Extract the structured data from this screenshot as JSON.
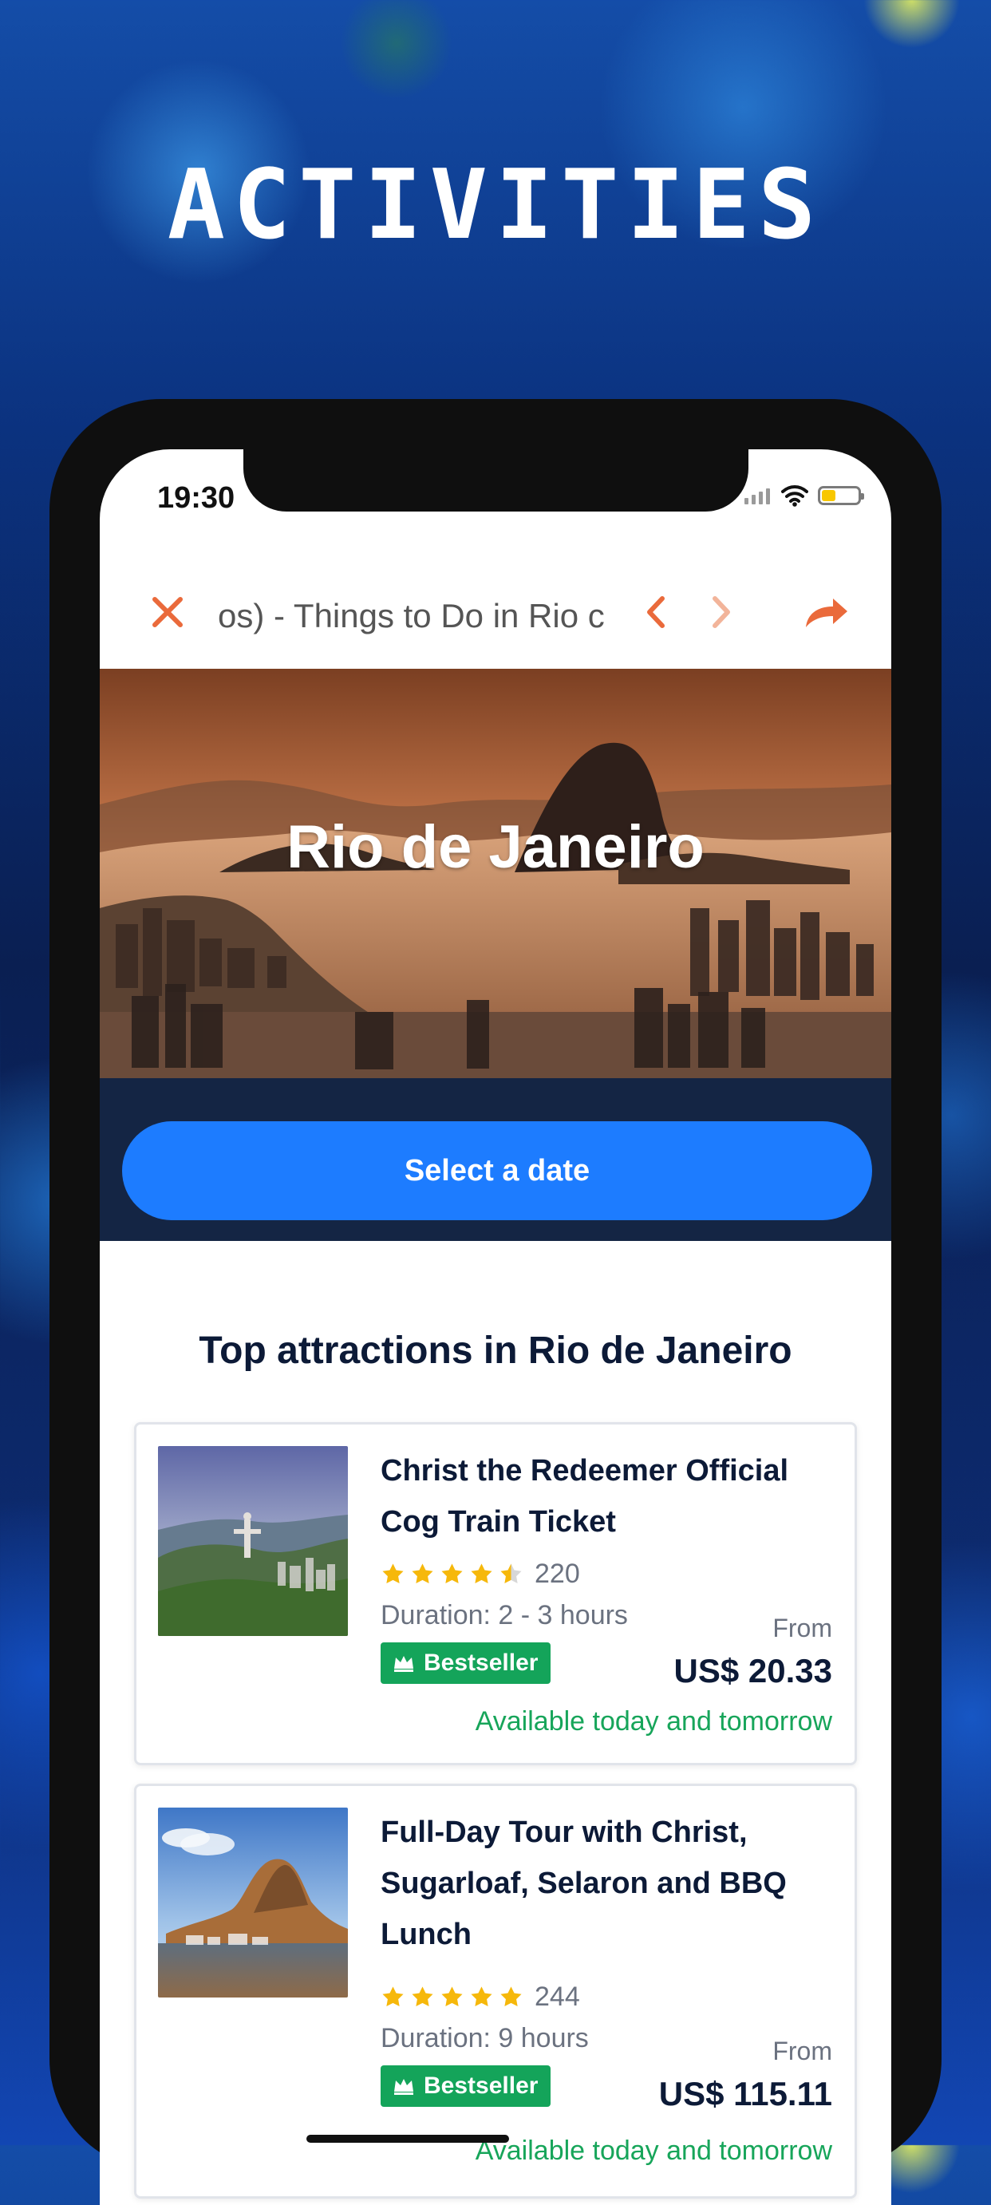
{
  "page": {
    "heading": "ACTIVITIES"
  },
  "status_bar": {
    "time": "19:30",
    "icons": [
      "cellular-signal-icon",
      "wifi-icon",
      "battery-icon"
    ]
  },
  "browser": {
    "url_text": "os) - Things to Do in Rio c",
    "icons": [
      "close-icon",
      "chevron-left-icon",
      "chevron-right-icon",
      "share-icon"
    ],
    "accent_color": "#ea6a3b"
  },
  "hero": {
    "title": "Rio de Janeiro"
  },
  "date_picker": {
    "button_label": "Select a date",
    "button_color": "#1d7cff",
    "band_color": "#142544"
  },
  "section": {
    "title": "Top attractions in Rio de Janeiro"
  },
  "cards": [
    {
      "title": "Christ the Redeemer Official Cog Train Ticket",
      "rating_stars": 4.5,
      "review_count": "220",
      "duration": "Duration: 2 - 3 hours",
      "badge": "Bestseller",
      "from_label": "From",
      "price": "US$ 20.33",
      "availability": "Available today and tomorrow",
      "image_icon": "christ-redeemer-photo"
    },
    {
      "title": "Full-Day Tour with Christ, Sugarloaf, Selaron and BBQ Lunch",
      "rating_stars": 5,
      "review_count": "244",
      "duration": "Duration: 9 hours",
      "badge": "Bestseller",
      "from_label": "From",
      "price": "US$ 115.11",
      "availability": "Available today and tomorrow",
      "image_icon": "sugarloaf-photo"
    }
  ],
  "colors": {
    "star": "#f6b80b",
    "badge": "#14a45a",
    "availability": "#17a55a",
    "text_dark": "#0c1a37",
    "text_muted": "#6b7280"
  }
}
